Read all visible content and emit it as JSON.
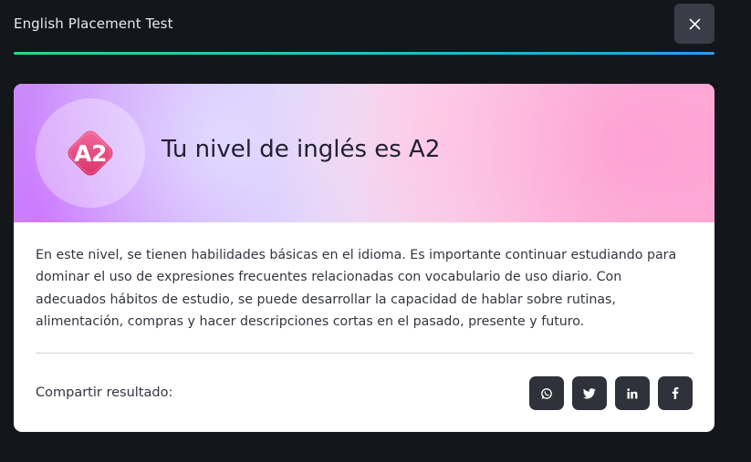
{
  "header": {
    "title": "English Placement Test",
    "close_icon": "close-icon"
  },
  "progress": {
    "value": 1.0,
    "colors": [
      "#2fd48a",
      "#2b9bf2"
    ]
  },
  "result": {
    "badge": "A2",
    "heading": "Tu nivel de inglés es A2",
    "description": "En este nivel, se tienen habilidades básicas en el idioma. Es importante continuar estudiando para dominar el uso de expresiones frecuentes relacionadas con vocabulario de uso diario. Con adecuados hábitos de estudio, se puede desarrollar la capacidad de hablar sobre rutinas, alimentación, compras y hacer descripciones cortas en el pasado, presente y futuro."
  },
  "share": {
    "label": "Compartir resultado:",
    "buttons": [
      {
        "icon": "whatsapp-icon"
      },
      {
        "icon": "twitter-icon"
      },
      {
        "icon": "linkedin-icon"
      },
      {
        "icon": "facebook-icon"
      }
    ]
  },
  "colors": {
    "background": "#14161b",
    "button_dark": "#2f323a",
    "badge_pink": "#e8457e"
  }
}
